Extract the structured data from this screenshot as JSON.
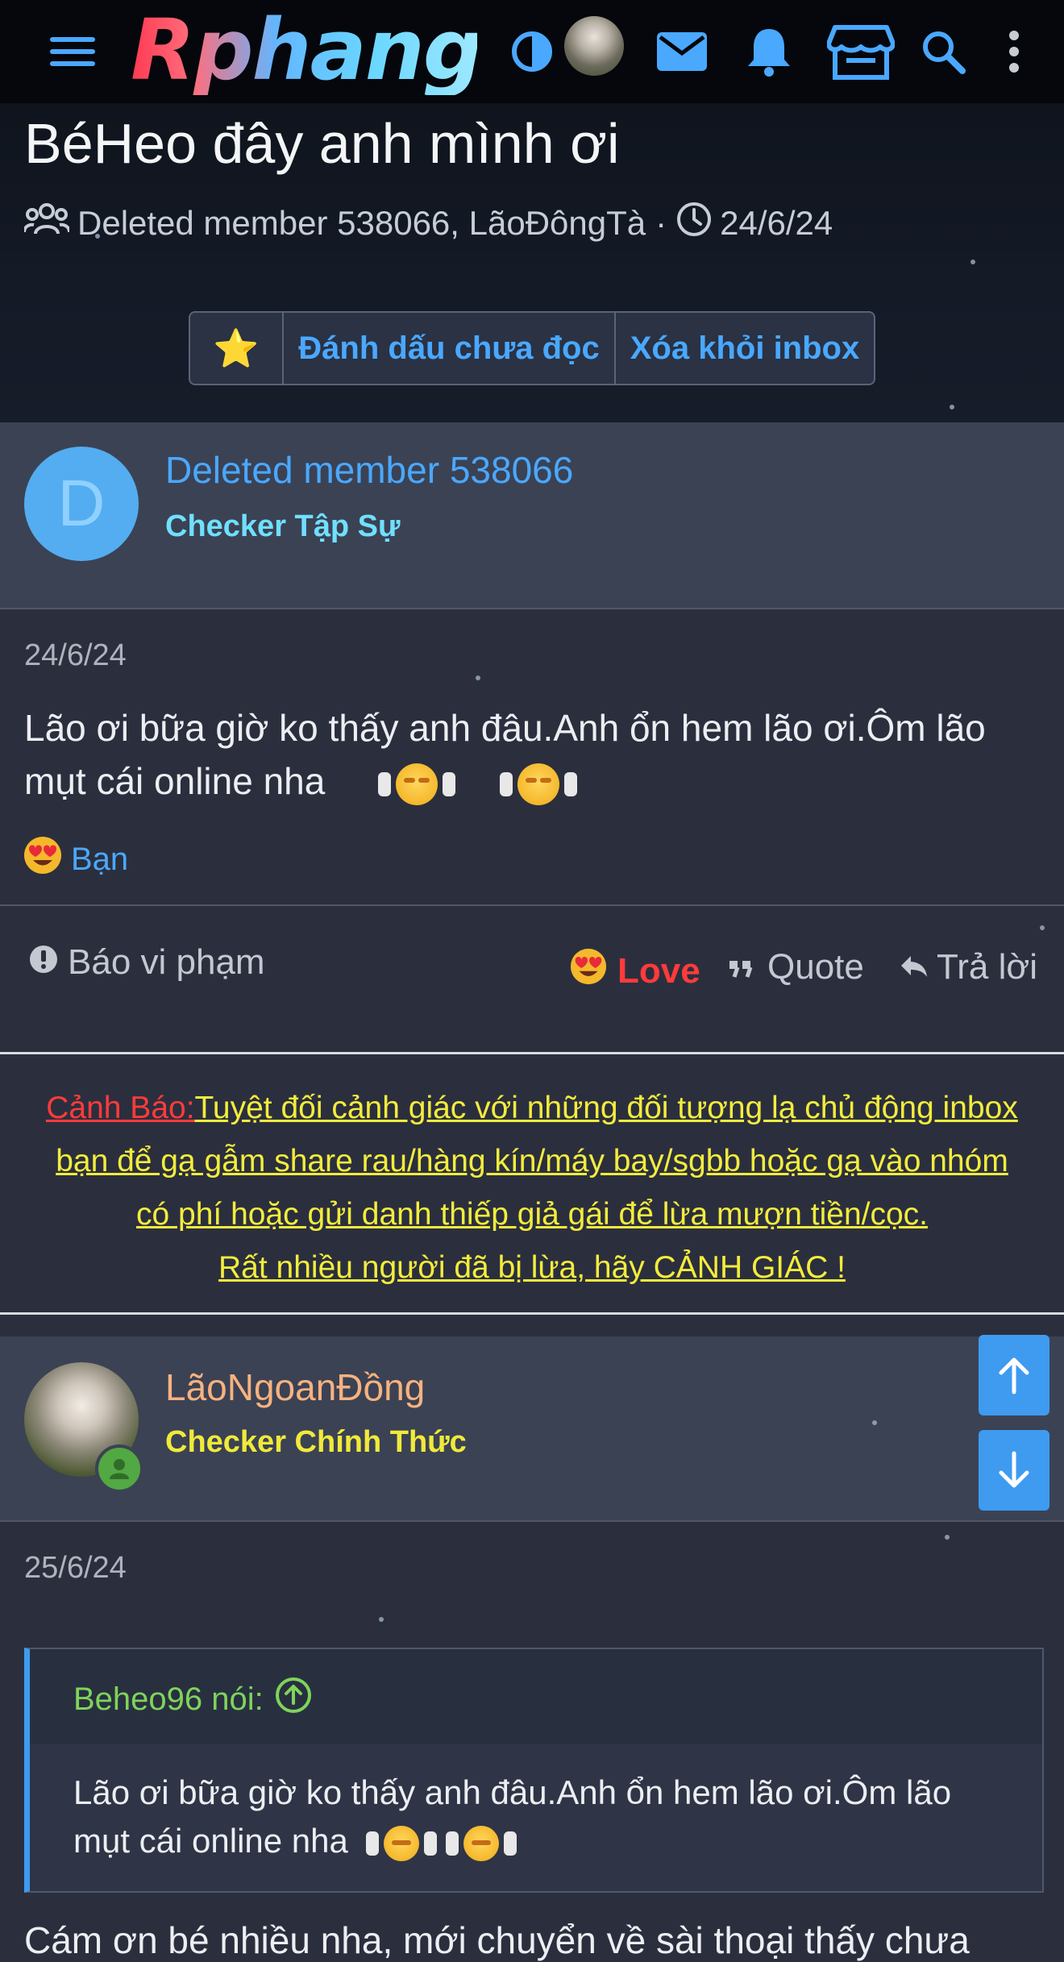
{
  "topbar": {
    "logo_text": "Rphang",
    "icons": [
      "menu-icon",
      "theme-toggle-icon",
      "mail-icon",
      "bell-icon",
      "store-icon",
      "search-icon",
      "more-vertical-icon"
    ]
  },
  "thread": {
    "title": "BéHeo đây anh mình ơi",
    "participants": "Deleted member 538066, LãoĐôngTà",
    "separator": "·",
    "date": "24/6/24",
    "buttons": {
      "star": "⭐",
      "mark_unread": "Đánh dấu chưa đọc",
      "remove_inbox": "Xóa khỏi inbox"
    }
  },
  "post1": {
    "avatar_letter": "D",
    "username": "Deleted member 538066",
    "user_title": "Checker Tập Sự",
    "date": "24/6/24",
    "text_line1": "Lão ơi bữa giờ ko thấy anh đâu.Anh ổn hem lão ơi.Ôm lão",
    "text_line2": "mụt cái online nha",
    "reaction_user": "Bạn",
    "actions": {
      "report": "Báo vi phạm",
      "love": "Love",
      "quote": "Quote",
      "reply": "Trả lời"
    }
  },
  "warning": {
    "label": "Cảnh Báo:",
    "line1": "Tuyệt đối cảnh giác với những đối tượng lạ chủ động inbox",
    "line2": "bạn để gạ gẫm share rau/hàng kín/máy bay/sgbb hoặc gạ vào nhóm",
    "line3": "có phí hoặc gửi danh thiếp giả gái để lừa mượn tiền/cọc.",
    "line4": "Rất nhiều người đã bị lừa, hãy CẢNH GIÁC !"
  },
  "post2": {
    "username": "LãoNgoanĐồng",
    "user_title": "Checker Chính Thức",
    "date": "25/6/24",
    "quote_author": "Beheo96 nói:",
    "quote_line1": "Lão ơi bữa giờ ko thấy anh đâu.Anh ổn hem lão ơi.Ôm lão",
    "quote_line2": "mụt cái online nha",
    "partial_line": "Cám ơn bé nhiều nha, mới chuyển về sài thoại thấy chưa"
  },
  "colors": {
    "accent": "#4aa8ff",
    "user_title_1": "#6fe0ff",
    "user_title_2": "#f0ea3a",
    "username_2": "#f7b27f",
    "love": "#ff3b3b",
    "warning_text": "#f3ec3d"
  }
}
